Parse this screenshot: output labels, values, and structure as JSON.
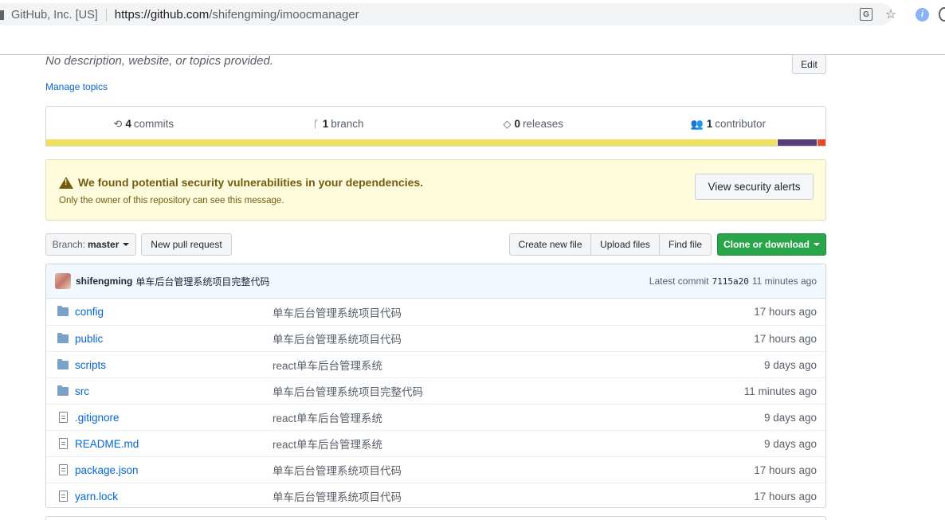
{
  "browser": {
    "cert_label": "GitHub, Inc. [US]",
    "url_host": "https://github.com",
    "url_path": "/shifengming/imoocmanager",
    "icons": [
      "lock-icon",
      "translate-icon",
      "star-icon",
      "extension-icon",
      "profile-icon"
    ]
  },
  "repo": {
    "description": "No description, website, or topics provided.",
    "edit_label": "Edit",
    "manage_topics": "Manage topics"
  },
  "summary": {
    "commits_count": "4",
    "commits_label": "commits",
    "branch_count": "1",
    "branch_label": "branch",
    "releases_count": "0",
    "releases_label": "releases",
    "contributor_count": "1",
    "contributor_label": "contributor",
    "languages": [
      {
        "color": "#f1e05a",
        "fraction": 0.94
      },
      {
        "color": "#563d7c",
        "fraction": 0.05
      },
      {
        "color": "#e34c26",
        "fraction": 0.01
      }
    ]
  },
  "alert": {
    "title": "We found potential security vulnerabilities in your dependencies.",
    "subtitle": "Only the owner of this repository can see this message.",
    "button": "View security alerts"
  },
  "toolbar": {
    "branch_prefix": "Branch:",
    "branch_name": "master",
    "new_pr": "New pull request",
    "create_file": "Create new file",
    "upload_files": "Upload files",
    "find_file": "Find file",
    "clone": "Clone or download"
  },
  "commit": {
    "author": "shifengming",
    "message": "单车后台管理系统项目完整代码",
    "latest_label": "Latest commit",
    "sha": "7115a20",
    "age": "11 minutes ago"
  },
  "files": [
    {
      "type": "dir",
      "name": "config",
      "message": "单车后台管理系统项目代码",
      "age": "17 hours ago"
    },
    {
      "type": "dir",
      "name": "public",
      "message": "单车后台管理系统项目代码",
      "age": "17 hours ago"
    },
    {
      "type": "dir",
      "name": "scripts",
      "message": "react单车后台管理系统",
      "age": "9 days ago"
    },
    {
      "type": "dir",
      "name": "src",
      "message": "单车后台管理系统项目完整代码",
      "age": "11 minutes ago"
    },
    {
      "type": "file",
      "name": ".gitignore",
      "message": "react单车后台管理系统",
      "age": "9 days ago"
    },
    {
      "type": "file",
      "name": "README.md",
      "message": "react单车后台管理系统",
      "age": "9 days ago"
    },
    {
      "type": "file",
      "name": "package.json",
      "message": "单车后台管理系统项目代码",
      "age": "17 hours ago"
    },
    {
      "type": "file",
      "name": "yarn.lock",
      "message": "单车后台管理系统项目代码",
      "age": "17 hours ago"
    }
  ]
}
